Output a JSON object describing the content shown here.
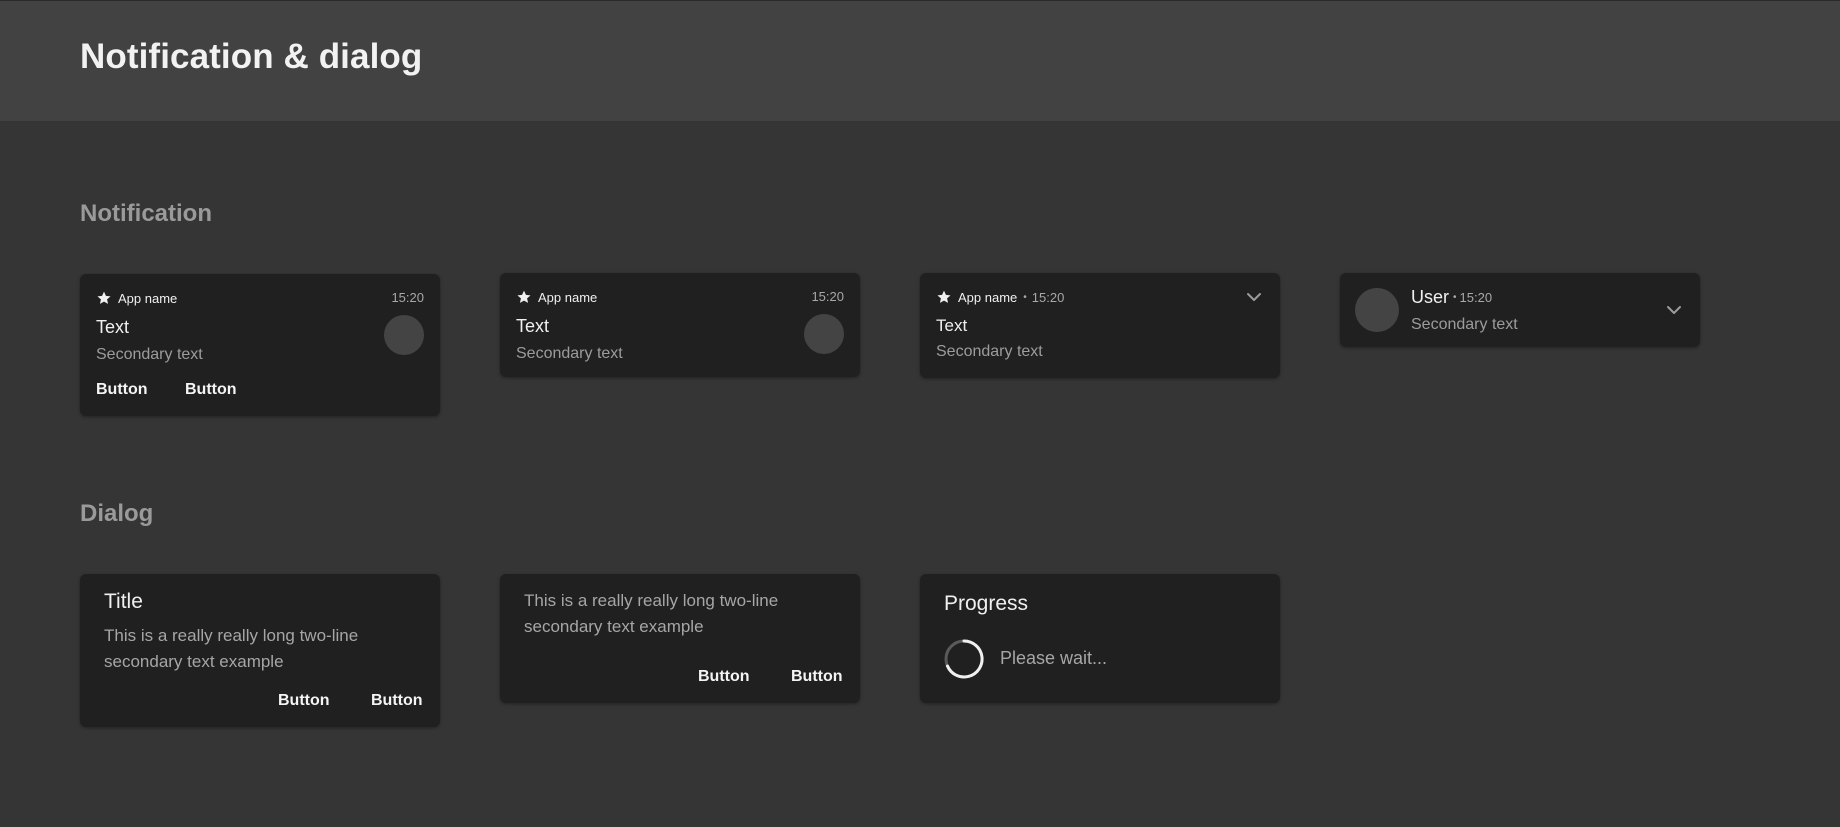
{
  "header": {
    "title": "Notification & dialog"
  },
  "sections": {
    "notification": "Notification",
    "dialog": "Dialog"
  },
  "notifications": [
    {
      "app_name": "App name",
      "time": "15:20",
      "text": "Text",
      "secondary": "Secondary text",
      "buttons": [
        "Button",
        "Button"
      ]
    },
    {
      "app_name": "App name",
      "time": "15:20",
      "text": "Text",
      "secondary": "Secondary text"
    },
    {
      "app_name": "App name",
      "separator": "•",
      "time": "15:20",
      "text": "Text",
      "secondary": "Secondary text"
    },
    {
      "user": "User",
      "separator": "•",
      "time": "15:20",
      "secondary": "Secondary text"
    }
  ],
  "dialogs": [
    {
      "title": "Title",
      "body": "This is a really really long two-line secondary text example",
      "buttons": [
        "Button",
        "Button"
      ]
    },
    {
      "body": "This is a really really long two-line secondary text example",
      "buttons": [
        "Button",
        "Button"
      ]
    },
    {
      "title": "Progress",
      "message": "Please wait..."
    }
  ],
  "colors": {
    "background": "#353535",
    "header": "#424242",
    "card": "#202020",
    "avatar": "#444444",
    "secondary_text": "#9c9c9c"
  },
  "icons": {
    "app": "star-icon",
    "expand": "chevron-down-icon",
    "progress": "spinner-icon"
  }
}
